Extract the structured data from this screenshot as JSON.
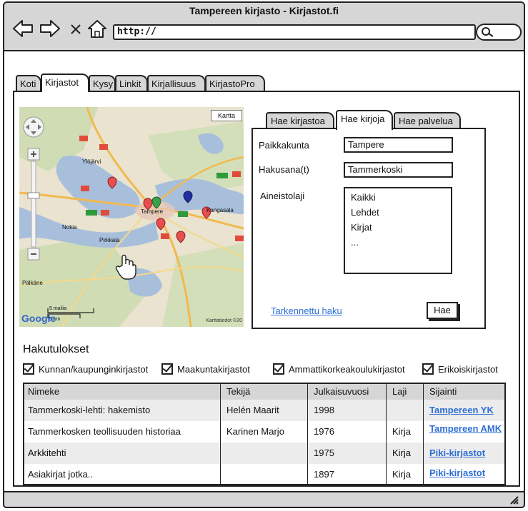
{
  "window": {
    "title": "Tampereen kirjasto - Kirjastot.fi"
  },
  "address_bar": {
    "url": "http://"
  },
  "main_tabs": [
    {
      "label": "Koti",
      "active": false
    },
    {
      "label": "Kirjastot",
      "active": true
    },
    {
      "label": "Kysy",
      "active": false
    },
    {
      "label": "Linkit",
      "active": false
    },
    {
      "label": "Kirjallisuus",
      "active": false
    },
    {
      "label": "KirjastoPro",
      "active": false
    }
  ],
  "map": {
    "type_button": "Kartta",
    "attribution": "Karttatiedot ©20",
    "scale_top": "5 mailia",
    "scale_bottom": "5 km",
    "places": [
      "Ylöjärvi",
      "Tampere",
      "Nokia",
      "Pirkkala",
      "Kangasala",
      "Pälkäne"
    ]
  },
  "search_tabs": [
    {
      "label": "Hae kirjastoa",
      "active": false
    },
    {
      "label": "Hae kirjoja",
      "active": true
    },
    {
      "label": "Hae palvelua",
      "active": false
    }
  ],
  "form": {
    "paikkakunta_label": "Paikkakunta",
    "paikkakunta_value": "Tampere",
    "hakusana_label": "Hakusana(t)",
    "hakusana_value": "Tammerkoski",
    "aineistolaji_label": "Aineistolaji",
    "aineistolaji_options": [
      "Kaikki",
      "Lehdet",
      "Kirjat",
      "..."
    ],
    "advanced_link": "Tarkennettu haku",
    "search_button": "Hae"
  },
  "results": {
    "title": "Hakutulokset",
    "filters": [
      {
        "label": "Kunnan/kaupunginkirjastot",
        "checked": true
      },
      {
        "label": "Maakuntakirjastot",
        "checked": true
      },
      {
        "label": "Ammattikorkeakoulukirjastot",
        "checked": true
      },
      {
        "label": "Erikoiskirjastot",
        "checked": true
      }
    ],
    "columns": [
      "Nimeke",
      "Tekijä",
      "Julkaisuvuosi",
      "Laji",
      "Sijainti"
    ],
    "rows": [
      [
        "Tammerkoski-lehti: hakemisto",
        "Helén Maarit",
        "1998",
        "",
        "Tampereen YK"
      ],
      [
        "Tammerkosken teollisuuden historiaa",
        "Karinen Marjo",
        "1976",
        "Kirja",
        "Tampereen AMK"
      ],
      [
        "Arkkitehti",
        "",
        "1975",
        "Kirja",
        "Piki-kirjastot"
      ],
      [
        "Asiakirjat jotka..",
        "",
        "1897",
        "Kirja",
        "Piki-kirjastot"
      ]
    ]
  },
  "colors": {
    "chrome": "#d6d6d6",
    "link": "#2f6fd6",
    "stripe": "#ececec",
    "map_land": "#e9e3cf",
    "map_water": "#a8bfdc"
  }
}
